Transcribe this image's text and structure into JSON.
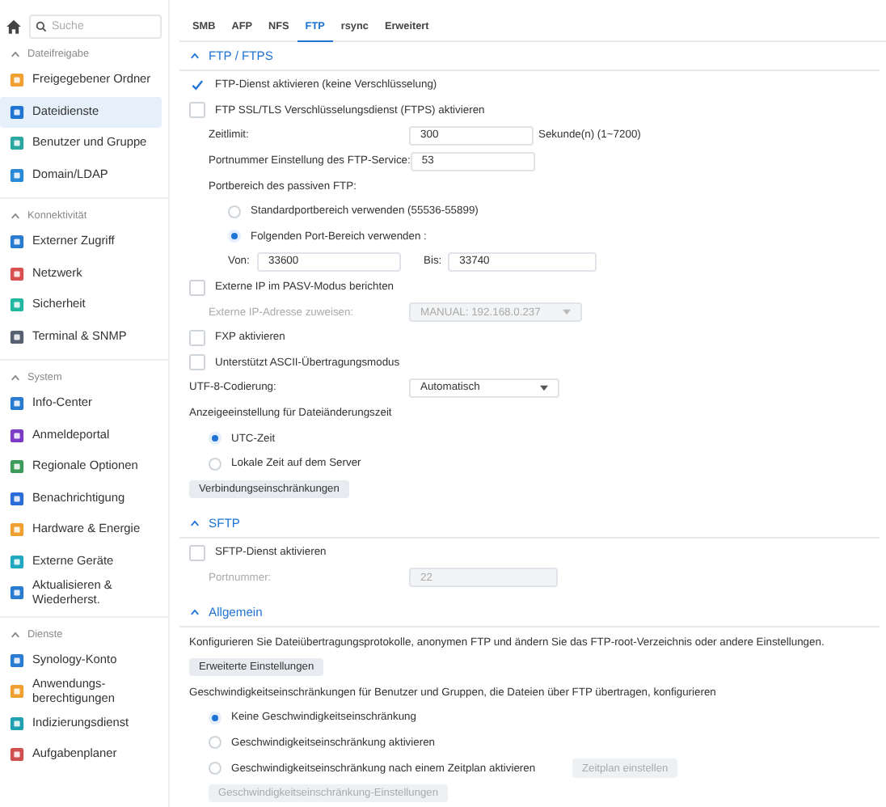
{
  "sidebar": {
    "search": {
      "placeholder": "Suche"
    },
    "sections": [
      {
        "title": "Dateifreigabe",
        "expanded": true,
        "items": [
          {
            "label": "Freigegebener Ordner",
            "selected": false
          },
          {
            "label": "Dateidienste",
            "selected": true
          },
          {
            "label": "Benutzer und Gruppe",
            "selected": false
          },
          {
            "label": "Domain/LDAP",
            "selected": false
          }
        ]
      },
      {
        "title": "Konnektivität",
        "expanded": true,
        "items": [
          {
            "label": "Externer Zugriff",
            "selected": false
          },
          {
            "label": "Netzwerk",
            "selected": false
          },
          {
            "label": "Sicherheit",
            "selected": false
          },
          {
            "label": "Terminal & SNMP",
            "selected": false
          }
        ]
      },
      {
        "title": "System",
        "expanded": true,
        "items": [
          {
            "label": "Info-Center",
            "selected": false
          },
          {
            "label": "Anmeldeportal",
            "selected": false
          },
          {
            "label": "Regionale Optionen",
            "selected": false
          },
          {
            "label": "Benachrichtigung",
            "selected": false
          },
          {
            "label": "Hardware & Energie",
            "selected": false
          },
          {
            "label": "Externe Geräte",
            "selected": false
          },
          {
            "label": "Aktualisieren & Wiederherst.",
            "selected": false
          }
        ]
      },
      {
        "title": "Dienste",
        "expanded": true,
        "items": [
          {
            "label": "Synology-Konto",
            "selected": false
          },
          {
            "label": "Anwendungs-berechtigungen",
            "selected": false
          },
          {
            "label": "Indizierungsdienst",
            "selected": false
          },
          {
            "label": "Aufgabenplaner",
            "selected": false
          }
        ]
      }
    ]
  },
  "tabs": [
    {
      "label": "SMB",
      "selected": false
    },
    {
      "label": "AFP",
      "selected": false
    },
    {
      "label": "NFS",
      "selected": false
    },
    {
      "label": "FTP",
      "selected": true
    },
    {
      "label": "rsync",
      "selected": false
    },
    {
      "label": "Erweitert",
      "selected": false
    }
  ],
  "sections": [
    {
      "title": "FTP / FTPS",
      "expanded": true,
      "rows": [
        {
          "kind": "checkbox",
          "label": "FTP-Dienst aktivieren (keine Verschlüsselung)",
          "checked": true
        },
        {
          "kind": "checkbox",
          "label": "FTP SSL/TLS Verschlüsselungsdienst (FTPS) aktivieren",
          "checked": false,
          "children": [
            {
              "kind": "field",
              "label": "Zeitlimit:",
              "value": "300",
              "suffix": "Sekunde(n) (1~7200)",
              "disabled": false
            },
            {
              "kind": "field",
              "label": "Portnummer Einstellung des FTP-Service:",
              "value": "53",
              "disabled": false
            },
            {
              "kind": "label",
              "label": "Portbereich des passiven FTP:",
              "children": [
                {
                  "kind": "radio",
                  "label": "Standardportbereich verwenden (55536-55899)",
                  "selected": false
                },
                {
                  "kind": "radio",
                  "label": "Folgenden Port-Bereich verwenden :",
                  "selected": true
                },
                {
                  "kind": "range",
                  "from_label": "Von:",
                  "from": "33600",
                  "to_label": "Bis:",
                  "to": "33740"
                }
              ]
            }
          ]
        },
        {
          "kind": "checkbox",
          "label": "Externe IP im PASV-Modus berichten",
          "checked": false,
          "children": [
            {
              "kind": "select",
              "label": "Externe IP-Adresse zuweisen:",
              "value": "MANUAL: 192.168.0.237",
              "disabled": true
            }
          ]
        },
        {
          "kind": "checkbox",
          "label": "FXP aktivieren",
          "checked": false
        },
        {
          "kind": "checkbox",
          "label": "Unterstützt ASCII-Übertragungsmodus",
          "checked": false
        },
        {
          "kind": "select",
          "label": "UTF-8-Codierung:",
          "value": "Automatisch",
          "disabled": false
        },
        {
          "kind": "label",
          "label": "Anzeigeeinstellung für Dateiänderungszeit",
          "children": [
            {
              "kind": "radio",
              "label": "UTC-Zeit",
              "selected": true
            },
            {
              "kind": "radio",
              "label": "Lokale Zeit auf dem Server",
              "selected": false
            }
          ]
        },
        {
          "kind": "button",
          "label": "Verbindungseinschränkungen",
          "disabled": false
        }
      ]
    },
    {
      "title": "SFTP",
      "expanded": true,
      "rows": [
        {
          "kind": "checkbox",
          "label": "SFTP-Dienst aktivieren",
          "checked": false,
          "children": [
            {
              "kind": "field",
              "label": "Portnummer:",
              "value": "22",
              "disabled": true
            }
          ]
        }
      ]
    },
    {
      "title": "Allgemein",
      "expanded": true,
      "rows": [
        {
          "kind": "label",
          "label": "Konfigurieren Sie Dateiübertragungsprotokolle, anonymen FTP und ändern Sie das FTP-root-Verzeichnis oder andere Einstellungen."
        },
        {
          "kind": "button",
          "label": "Erweiterte Einstellungen",
          "disabled": false
        },
        {
          "kind": "label",
          "label": "Geschwindigkeitseinschränkungen für Benutzer und Gruppen, die Dateien über FTP übertragen, konfigurieren",
          "children": [
            {
              "kind": "radio",
              "label": "Keine Geschwindigkeitseinschränkung",
              "selected": true
            },
            {
              "kind": "radio",
              "label": "Geschwindigkeitseinschränkung aktivieren",
              "selected": false
            },
            {
              "kind": "radio",
              "label": "Geschwindigkeitseinschränkung nach einem Zeitplan aktivieren",
              "selected": false,
              "action": {
                "label": "Zeitplan einstellen",
                "disabled": true
              }
            },
            {
              "kind": "button",
              "label": "Geschwindigkeitseinschränkung-Einstellungen",
              "disabled": true
            }
          ]
        }
      ]
    }
  ]
}
